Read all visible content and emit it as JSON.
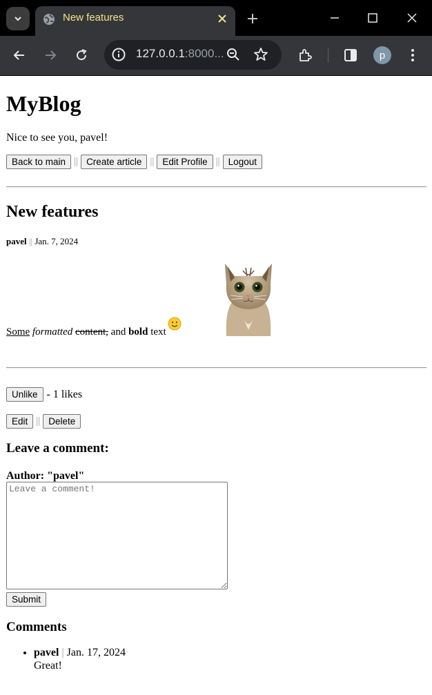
{
  "browser": {
    "tab_title": "New features",
    "url_host": "127.0.0.1",
    "url_rest": ":8000...",
    "profile_initial": "p"
  },
  "site": {
    "title": "MyBlog",
    "greeting": "Nice to see you, pavel!"
  },
  "nav": {
    "back": "Back to main",
    "create": "Create article",
    "edit_profile": "Edit Profile",
    "logout": "Logout",
    "separator": "||"
  },
  "post": {
    "title": "New features",
    "author": "pavel",
    "date": "Jan. 7, 2024",
    "body": {
      "some": "Some",
      "formatted": "formatted",
      "content": "content,",
      "and": "and",
      "bold": "bold",
      "text": "text"
    }
  },
  "likes": {
    "button": "Unlike",
    "text": "- 1 likes"
  },
  "post_actions": {
    "edit": "Edit",
    "delete": "Delete"
  },
  "comment_form": {
    "heading": "Leave a comment:",
    "author_label": "Author: \"pavel\"",
    "placeholder": "Leave a comment!",
    "submit": "Submit"
  },
  "comments": {
    "heading": "Comments",
    "items": [
      {
        "author": "pavel",
        "separator": "|",
        "date": "Jan. 17, 2024",
        "text": "Great!"
      }
    ]
  },
  "colors": {
    "tab_title": "#f2e38d",
    "chrome_dark": "#35363a"
  }
}
